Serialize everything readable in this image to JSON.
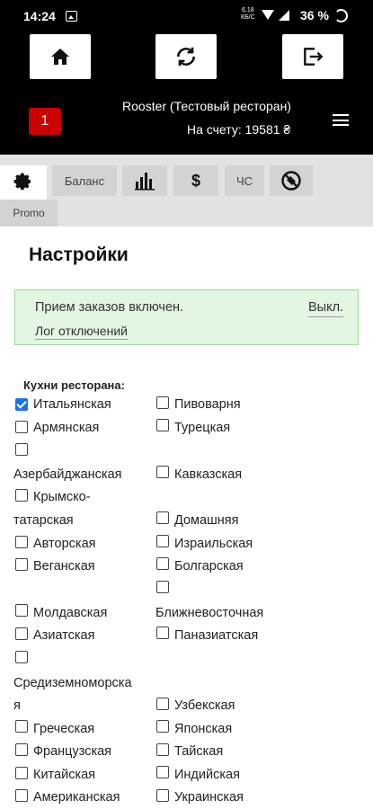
{
  "status_bar": {
    "time": "14:24",
    "net_speed": "6,18",
    "net_unit": "КБ/С",
    "battery": "36 %"
  },
  "header": {
    "restaurant": "Rooster (Тестовый ресторан)",
    "balance": "На счету: 19581 ₴",
    "notification_count": "1",
    "buttons": {
      "home_icon": "home-icon",
      "refresh_icon": "refresh-icon",
      "logout_icon": "logout-icon"
    }
  },
  "tabs": {
    "balance": "Баланс",
    "dollar": "$",
    "cs": "ЧС",
    "promo": "Promo"
  },
  "page_title": "Настройки",
  "orders_alert": {
    "message": "Прием заказов включен.",
    "off_button": "Выкл.",
    "log_link": "Лог отключений"
  },
  "kitchens": {
    "label": "Кухни ресторана:",
    "items": [
      {
        "name": "Итальянская",
        "checked": true
      },
      {
        "name": "Пивоварня",
        "checked": false
      },
      {
        "name": "Армянская",
        "checked": false
      },
      {
        "name": "Турецкая",
        "checked": false
      },
      {
        "name": "Азербайджанская",
        "checked": false
      },
      {
        "name": "Кавказская",
        "checked": false
      },
      {
        "name": "Крымско-",
        "checked": false
      },
      {
        "name": "татарская",
        "checked": false
      },
      {
        "name": "Домашняя",
        "checked": false
      },
      {
        "name": "Авторская",
        "checked": false
      },
      {
        "name": "Израильская",
        "checked": false
      },
      {
        "name": "Веганская",
        "checked": false
      },
      {
        "name": "Болгарская",
        "checked": false
      },
      {
        "name": "Молдавская",
        "checked": false
      },
      {
        "name": "Ближневосточная",
        "checked": false
      },
      {
        "name": "Азиатская",
        "checked": false
      },
      {
        "name": "Паназиатская",
        "checked": false
      },
      {
        "name": "Средиземноморска",
        "checked": false
      },
      {
        "name": "я",
        "checked": false
      },
      {
        "name": "Узбекская",
        "checked": false
      },
      {
        "name": "Греческая",
        "checked": false
      },
      {
        "name": "Японская",
        "checked": false
      },
      {
        "name": "Французская",
        "checked": false
      },
      {
        "name": "Тайская",
        "checked": false
      },
      {
        "name": "Китайская",
        "checked": false
      },
      {
        "name": "Индийская",
        "checked": false
      },
      {
        "name": "Американская",
        "checked": false
      },
      {
        "name": "Украинская",
        "checked": false
      }
    ]
  }
}
